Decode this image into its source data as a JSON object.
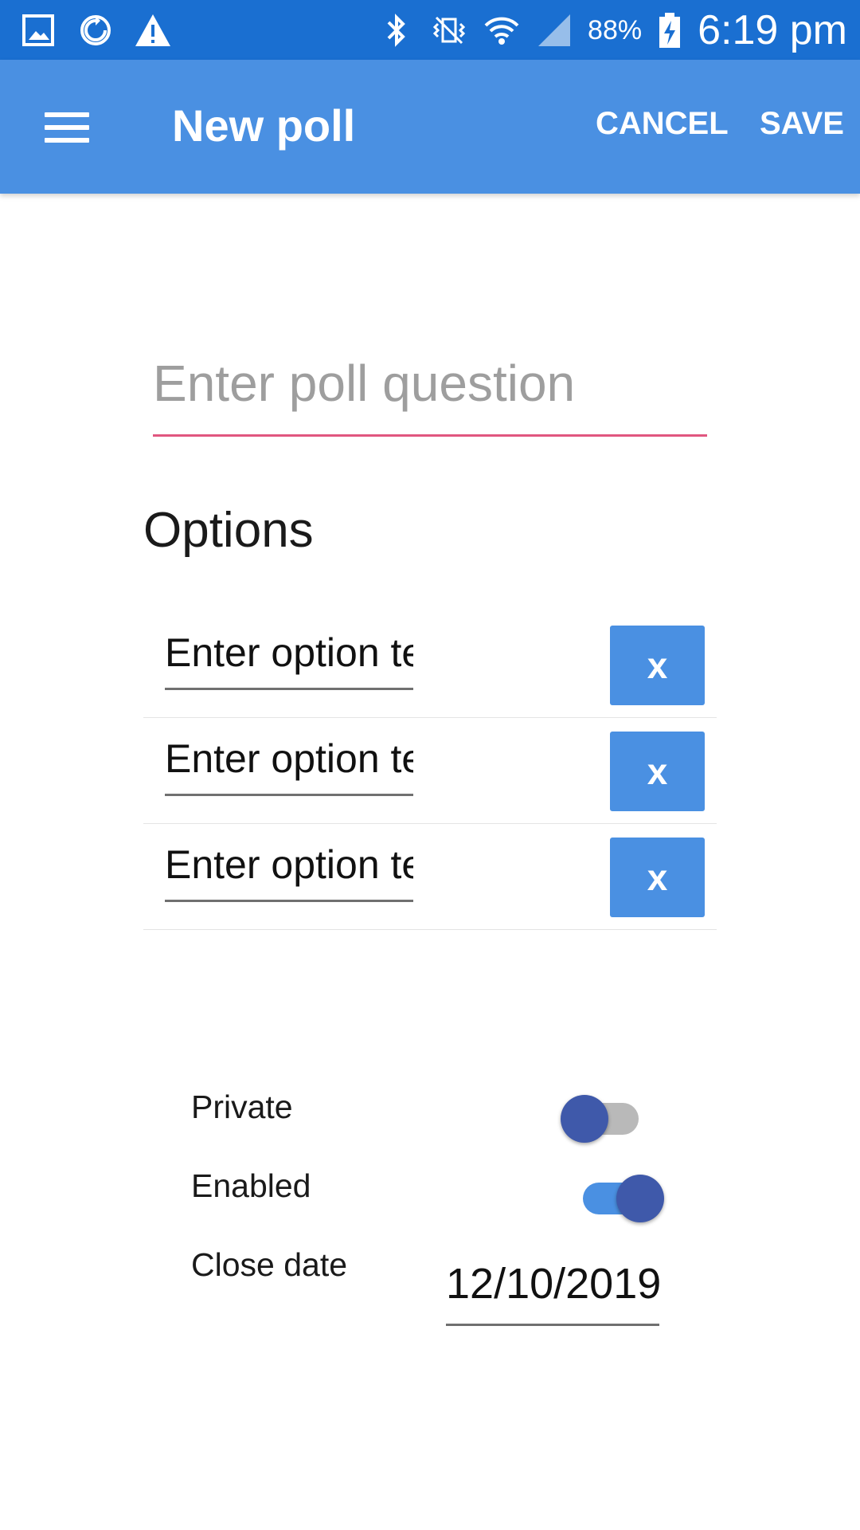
{
  "status_bar": {
    "battery_percent": "88%",
    "time": "6:19 pm",
    "icons": [
      "gallery-icon",
      "sync-icon",
      "warning-icon",
      "bluetooth-icon",
      "vibrate-icon",
      "wifi-icon",
      "cellular-signal-icon",
      "battery-charging-icon"
    ]
  },
  "app_bar": {
    "title": "New poll",
    "cancel_label": "CANCEL",
    "save_label": "SAVE",
    "color": "#4a90e2"
  },
  "question": {
    "placeholder": "Enter poll question",
    "value": ""
  },
  "options_heading": "Options",
  "options": [
    {
      "placeholder": "Enter option text",
      "remove_label": "x"
    },
    {
      "placeholder": "Enter option text",
      "remove_label": "x"
    },
    {
      "placeholder": "Enter option text",
      "remove_label": "x"
    }
  ],
  "settings": {
    "private_label": "Private",
    "private_value": false,
    "enabled_label": "Enabled",
    "enabled_value": true,
    "close_date_label": "Close date",
    "close_date_value": "12/10/2019"
  }
}
